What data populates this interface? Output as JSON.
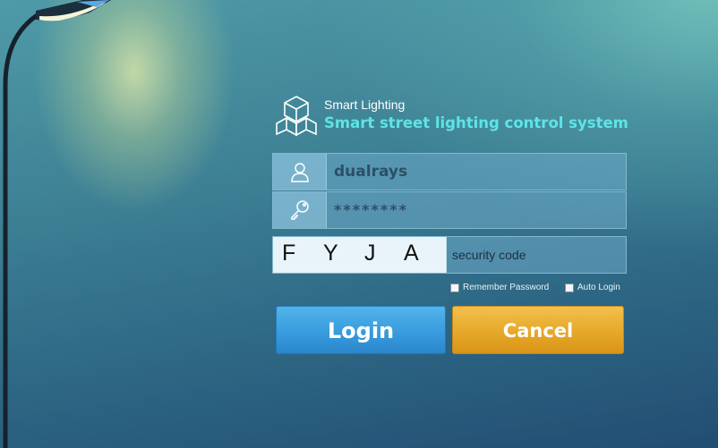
{
  "brand": {
    "name": "Smart Lighting",
    "slogan": "Smart street lighting control system",
    "logo_icon": "cube-network-icon"
  },
  "login_form": {
    "username": {
      "value": "dualrays",
      "icon": "user-icon"
    },
    "password": {
      "value": "********",
      "icon": "key-icon"
    },
    "captcha": {
      "chars": [
        "F",
        "Y",
        "J",
        "A"
      ],
      "label": "security code"
    },
    "options": {
      "remember_password": {
        "label": "Remember Password",
        "checked": false
      },
      "auto_login": {
        "label": "Auto Login",
        "checked": false
      }
    },
    "login_label": "Login",
    "cancel_label": "Cancel"
  },
  "colors": {
    "slogan": "#5ee4e6",
    "login_button": "#3a9ee0",
    "cancel_button": "#e6a82a",
    "background": "#2f6a86"
  }
}
